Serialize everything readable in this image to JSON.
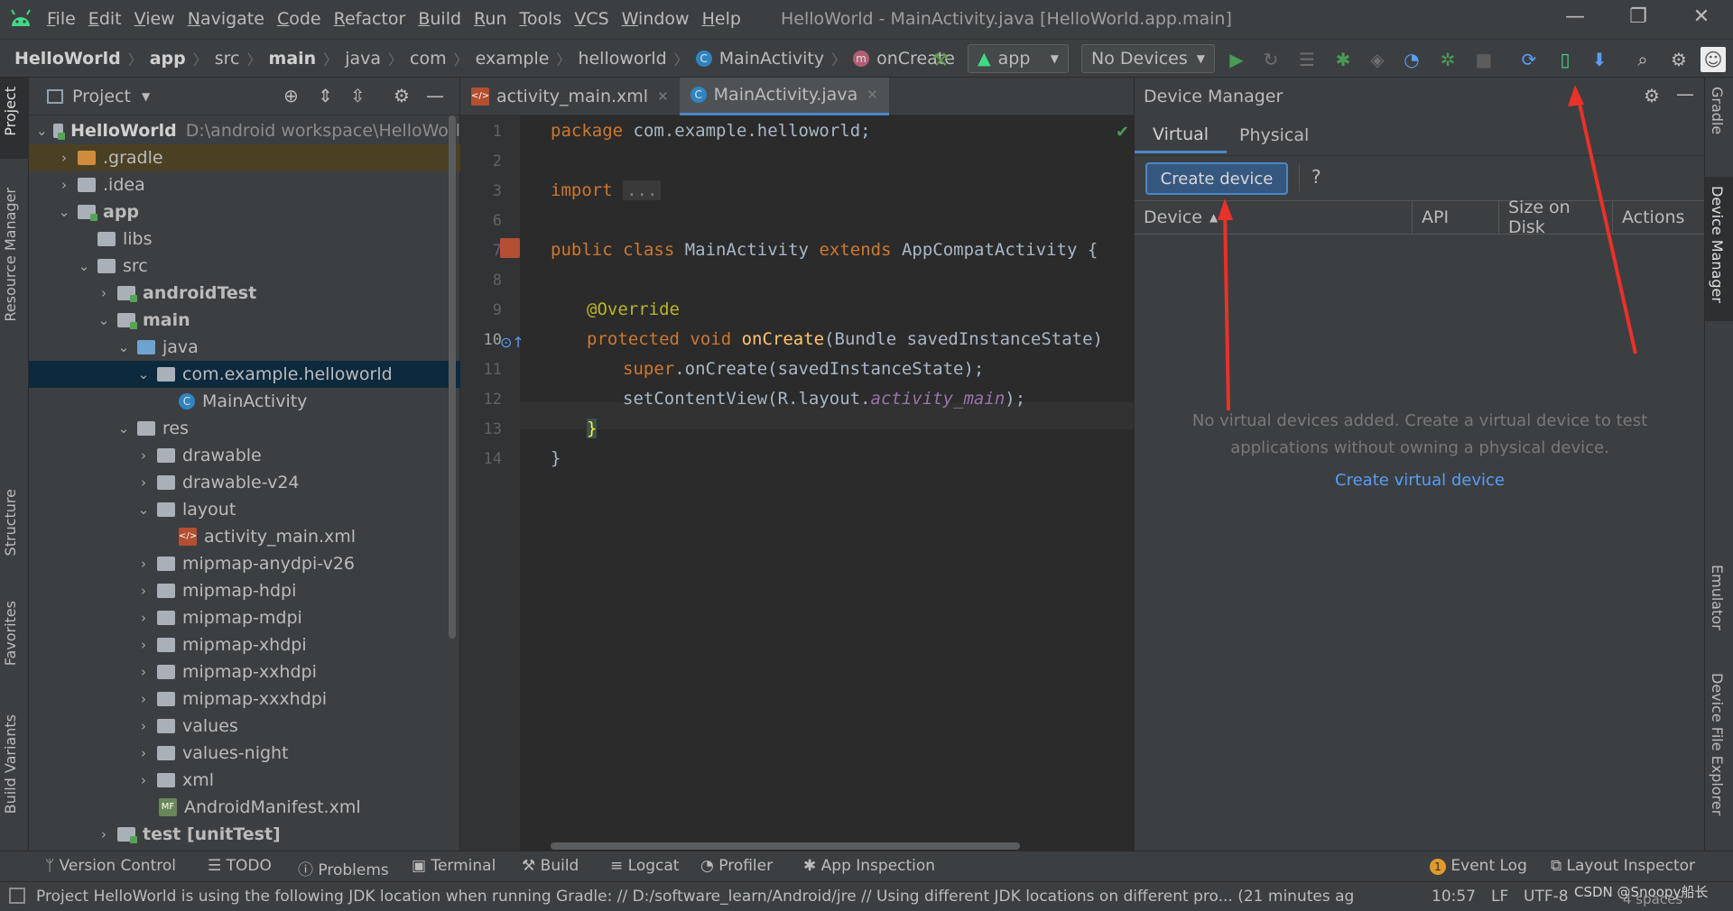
{
  "window": {
    "title": "HelloWorld - MainActivity.java [HelloWorld.app.main]",
    "menu": [
      "File",
      "Edit",
      "View",
      "Navigate",
      "Code",
      "Refactor",
      "Build",
      "Run",
      "Tools",
      "VCS",
      "Window",
      "Help"
    ]
  },
  "breadcrumb": [
    "HelloWorld",
    "app",
    "src",
    "main",
    "java",
    "com",
    "example",
    "helloworld",
    "MainActivity",
    "onCreate"
  ],
  "toolbar": {
    "run_config": "app",
    "device_selector": "No Devices"
  },
  "left_strip": [
    "Project",
    "Resource Manager",
    "Structure",
    "Favorites",
    "Build Variants"
  ],
  "project_panel": {
    "title": "Project",
    "root_name": "HelloWorld",
    "root_path": "D:\\android workspace\\HelloWorl",
    "items": [
      {
        "label": ".gradle",
        "level": 1
      },
      {
        "label": ".idea",
        "level": 1
      },
      {
        "label": "app",
        "level": 1
      },
      {
        "label": "libs",
        "level": 2
      },
      {
        "label": "src",
        "level": 2
      },
      {
        "label": "androidTest",
        "level": 3
      },
      {
        "label": "main",
        "level": 3
      },
      {
        "label": "java",
        "level": 4
      },
      {
        "label": "com.example.helloworld",
        "level": 5
      },
      {
        "label": "MainActivity",
        "level": 6
      },
      {
        "label": "res",
        "level": 4
      },
      {
        "label": "drawable",
        "level": 5
      },
      {
        "label": "drawable-v24",
        "level": 5
      },
      {
        "label": "layout",
        "level": 5
      },
      {
        "label": "activity_main.xml",
        "level": 6
      },
      {
        "label": "mipmap-anydpi-v26",
        "level": 5
      },
      {
        "label": "mipmap-hdpi",
        "level": 5
      },
      {
        "label": "mipmap-mdpi",
        "level": 5
      },
      {
        "label": "mipmap-xhdpi",
        "level": 5
      },
      {
        "label": "mipmap-xxhdpi",
        "level": 5
      },
      {
        "label": "mipmap-xxxhdpi",
        "level": 5
      },
      {
        "label": "values",
        "level": 5
      },
      {
        "label": "values-night",
        "level": 5
      },
      {
        "label": "xml",
        "level": 5
      },
      {
        "label": "AndroidManifest.xml",
        "level": 4
      },
      {
        "label": "test [unitTest]",
        "level": 3
      }
    ]
  },
  "editor": {
    "tabs": [
      {
        "label": "activity_main.xml",
        "active": false
      },
      {
        "label": "MainActivity.java",
        "active": true
      }
    ],
    "line_numbers": [
      "1",
      "2",
      "3",
      "6",
      "7",
      "8",
      "9",
      "10",
      "11",
      "12",
      "13",
      "14"
    ],
    "code": {
      "l1_kw": "package",
      "l1_rest": " com.example.helloworld;",
      "l3_kw": "import",
      "l3_fold": "...",
      "l7_kw1": "public class",
      "l7_name": " MainActivity ",
      "l7_kw2": "extends",
      "l7_rest": " AppCompatActivity {",
      "l9_ann": "@Override",
      "l10_kw": "protected void",
      "l10_fn": " onCreate",
      "l10_rest": "(Bundle savedInstanceState)",
      "l11_kw": "super",
      "l11_rest": ".onCreate(savedInstanceState);",
      "l12_pre": "setContentView(R.layout.",
      "l12_it": "activity_main",
      "l12_post": ");",
      "l13": "}",
      "l14": "}"
    }
  },
  "device_manager": {
    "title": "Device Manager",
    "tabs": [
      "Virtual",
      "Physical"
    ],
    "create_button": "Create device",
    "help": "?",
    "columns": [
      "Device",
      "API",
      "Size on Disk",
      "Actions"
    ],
    "empty_line1": "No virtual devices added. Create a virtual device to test",
    "empty_line2": "applications without owning a physical device.",
    "create_link": "Create virtual device"
  },
  "right_strip": [
    "Gradle",
    "Device Manager",
    "Emulator",
    "Device File Explorer"
  ],
  "bottom_tools": [
    "Version Control",
    "TODO",
    "Problems",
    "Terminal",
    "Build",
    "Logcat",
    "Profiler",
    "App Inspection"
  ],
  "bottom_right_tools": [
    "Event Log",
    "Layout Inspector"
  ],
  "event_count": "1",
  "status": {
    "message": "Project HelloWorld is using the following JDK location when running Gradle: // D:/software_learn/Android/jre // Using different JDK locations on different pro... (21 minutes ag",
    "position": "10:57",
    "line_sep": "LF",
    "encoding": "UTF-8",
    "indent": "4 spaces",
    "watermark": "CSDN @Snoopy船长"
  },
  "colors": {
    "accent": "#4a88c7",
    "annotation_arrow": "#e8322a",
    "run_green": "#499c54"
  }
}
